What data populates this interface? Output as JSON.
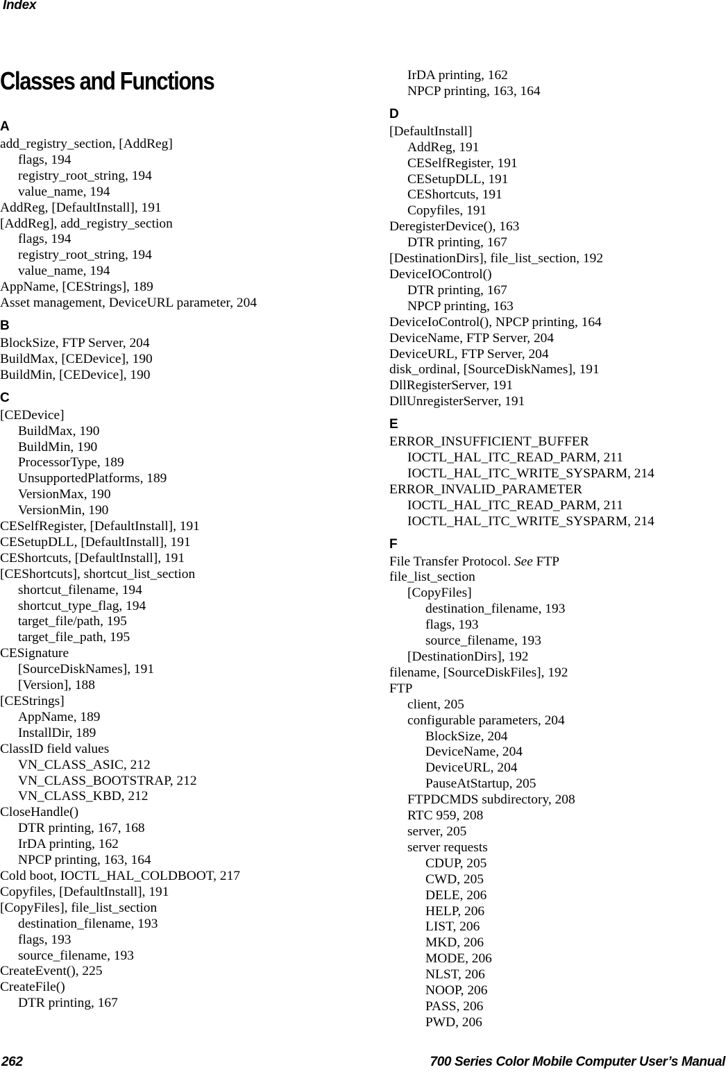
{
  "header": {
    "running_head": "Index"
  },
  "title": "Classes and Functions",
  "columns": [
    {
      "sections": [
        {
          "letter": "A",
          "entries": [
            {
              "level": 1,
              "text": "add_registry_section, [AddReg]"
            },
            {
              "level": 2,
              "text": "flags, 194"
            },
            {
              "level": 2,
              "text": "registry_root_string, 194"
            },
            {
              "level": 2,
              "text": "value_name, 194"
            },
            {
              "level": 1,
              "text": "AddReg, [DefaultInstall], 191"
            },
            {
              "level": 1,
              "text": "[AddReg], add_registry_section"
            },
            {
              "level": 2,
              "text": "flags, 194"
            },
            {
              "level": 2,
              "text": "registry_root_string, 194"
            },
            {
              "level": 2,
              "text": "value_name, 194"
            },
            {
              "level": 1,
              "text": "AppName, [CEStrings], 189"
            },
            {
              "level": 1,
              "text": "Asset management, DeviceURL parameter, 204"
            }
          ]
        },
        {
          "letter": "B",
          "entries": [
            {
              "level": 1,
              "text": "BlockSize, FTP Server, 204"
            },
            {
              "level": 1,
              "text": "BuildMax, [CEDevice], 190"
            },
            {
              "level": 1,
              "text": "BuildMin, [CEDevice], 190"
            }
          ]
        },
        {
          "letter": "C",
          "entries": [
            {
              "level": 1,
              "text": "[CEDevice]"
            },
            {
              "level": 2,
              "text": "BuildMax, 190"
            },
            {
              "level": 2,
              "text": "BuildMin, 190"
            },
            {
              "level": 2,
              "text": "ProcessorType, 189"
            },
            {
              "level": 2,
              "text": "UnsupportedPlatforms, 189"
            },
            {
              "level": 2,
              "text": "VersionMax, 190"
            },
            {
              "level": 2,
              "text": "VersionMin, 190"
            },
            {
              "level": 1,
              "text": "CESelfRegister, [DefaultInstall], 191"
            },
            {
              "level": 1,
              "text": "CESetupDLL, [DefaultInstall], 191"
            },
            {
              "level": 1,
              "text": "CEShortcuts, [DefaultInstall], 191"
            },
            {
              "level": 1,
              "text": "[CEShortcuts], shortcut_list_section"
            },
            {
              "level": 2,
              "text": "shortcut_filename, 194"
            },
            {
              "level": 2,
              "text": "shortcut_type_flag, 194"
            },
            {
              "level": 2,
              "text": "target_file/path, 195"
            },
            {
              "level": 2,
              "text": "target_file_path, 195"
            },
            {
              "level": 1,
              "text": "CESignature"
            },
            {
              "level": 2,
              "text": "[SourceDiskNames], 191"
            },
            {
              "level": 2,
              "text": "[Version], 188"
            },
            {
              "level": 1,
              "text": "[CEStrings]"
            },
            {
              "level": 2,
              "text": "AppName, 189"
            },
            {
              "level": 2,
              "text": "InstallDir, 189"
            },
            {
              "level": 1,
              "text": "ClassID field values"
            },
            {
              "level": 2,
              "text": "VN_CLASS_ASIC, 212"
            },
            {
              "level": 2,
              "text": "VN_CLASS_BOOTSTRAP, 212"
            },
            {
              "level": 2,
              "text": "VN_CLASS_KBD, 212"
            },
            {
              "level": 1,
              "text": "CloseHandle()"
            },
            {
              "level": 2,
              "text": "DTR printing, 167, 168"
            },
            {
              "level": 2,
              "text": "IrDA printing, 162"
            },
            {
              "level": 2,
              "text": "NPCP printing, 163, 164"
            },
            {
              "level": 1,
              "text": "Cold boot, IOCTL_HAL_COLDBOOT, 217"
            },
            {
              "level": 1,
              "text": "Copyfiles, [DefaultInstall], 191"
            },
            {
              "level": 1,
              "text": "[CopyFiles], file_list_section"
            },
            {
              "level": 2,
              "text": "destination_filename, 193"
            },
            {
              "level": 2,
              "text": "flags, 193"
            },
            {
              "level": 2,
              "text": "source_filename, 193"
            },
            {
              "level": 1,
              "text": "CreateEvent(), 225"
            },
            {
              "level": 1,
              "text": "CreateFile()"
            },
            {
              "level": 2,
              "text": "DTR printing, 167"
            }
          ]
        }
      ]
    },
    {
      "sections": [
        {
          "letter": "",
          "entries": [
            {
              "level": 2,
              "text": "IrDA printing, 162"
            },
            {
              "level": 2,
              "text": "NPCP printing, 163, 164"
            }
          ]
        },
        {
          "letter": "D",
          "entries": [
            {
              "level": 1,
              "text": "[DefaultInstall]"
            },
            {
              "level": 2,
              "text": "AddReg, 191"
            },
            {
              "level": 2,
              "text": "CESelfRegister, 191"
            },
            {
              "level": 2,
              "text": "CESetupDLL, 191"
            },
            {
              "level": 2,
              "text": "CEShortcuts, 191"
            },
            {
              "level": 2,
              "text": "Copyfiles, 191"
            },
            {
              "level": 1,
              "text": "DeregisterDevice(), 163"
            },
            {
              "level": 2,
              "text": "DTR printing, 167"
            },
            {
              "level": 1,
              "text": "[DestinationDirs], file_list_section, 192"
            },
            {
              "level": 1,
              "text": "DeviceIOControl()"
            },
            {
              "level": 2,
              "text": "DTR printing, 167"
            },
            {
              "level": 2,
              "text": "NPCP printing, 163"
            },
            {
              "level": 1,
              "text": "DeviceIoControl(), NPCP printing, 164"
            },
            {
              "level": 1,
              "text": "DeviceName, FTP Server, 204"
            },
            {
              "level": 1,
              "text": "DeviceURL, FTP Server, 204"
            },
            {
              "level": 1,
              "text": "disk_ordinal, [SourceDiskNames], 191"
            },
            {
              "level": 1,
              "text": "DllRegisterServer, 191"
            },
            {
              "level": 1,
              "text": "DllUnregisterServer, 191"
            }
          ]
        },
        {
          "letter": "E",
          "entries": [
            {
              "level": 1,
              "text": "ERROR_INSUFFICIENT_BUFFER"
            },
            {
              "level": 2,
              "text": "IOCTL_HAL_ITC_READ_PARM, 211"
            },
            {
              "level": 2,
              "text": "IOCTL_HAL_ITC_WRITE_SYSPARM, 214"
            },
            {
              "level": 1,
              "text": "ERROR_INVALID_PARAMETER"
            },
            {
              "level": 2,
              "text": "IOCTL_HAL_ITC_READ_PARM, 211"
            },
            {
              "level": 2,
              "text": "IOCTL_HAL_ITC_WRITE_SYSPARM, 214"
            }
          ]
        },
        {
          "letter": "F",
          "entries": [
            {
              "level": 1,
              "text": "File Transfer Protocol. ",
              "see": "See",
              "see_target": " FTP"
            },
            {
              "level": 1,
              "text": "file_list_section"
            },
            {
              "level": 2,
              "text": "[CopyFiles]"
            },
            {
              "level": 3,
              "text": "destination_filename, 193"
            },
            {
              "level": 3,
              "text": "flags, 193"
            },
            {
              "level": 3,
              "text": "source_filename, 193"
            },
            {
              "level": 2,
              "text": "[DestinationDirs], 192"
            },
            {
              "level": 1,
              "text": "filename, [SourceDiskFiles], 192"
            },
            {
              "level": 1,
              "text": "FTP"
            },
            {
              "level": 2,
              "text": "client, 205"
            },
            {
              "level": 2,
              "text": "configurable parameters, 204"
            },
            {
              "level": 3,
              "text": "BlockSize, 204"
            },
            {
              "level": 3,
              "text": "DeviceName, 204"
            },
            {
              "level": 3,
              "text": "DeviceURL, 204"
            },
            {
              "level": 3,
              "text": "PauseAtStartup, 205"
            },
            {
              "level": 2,
              "text": "FTPDCMDS subdirectory, 208"
            },
            {
              "level": 2,
              "text": "RTC 959, 208"
            },
            {
              "level": 2,
              "text": "server, 205"
            },
            {
              "level": 2,
              "text": "server requests"
            },
            {
              "level": 3,
              "text": "CDUP, 205"
            },
            {
              "level": 3,
              "text": "CWD, 205"
            },
            {
              "level": 3,
              "text": "DELE, 206"
            },
            {
              "level": 3,
              "text": "HELP, 206"
            },
            {
              "level": 3,
              "text": "LIST, 206"
            },
            {
              "level": 3,
              "text": "MKD, 206"
            },
            {
              "level": 3,
              "text": "MODE, 206"
            },
            {
              "level": 3,
              "text": "NLST, 206"
            },
            {
              "level": 3,
              "text": "NOOP, 206"
            },
            {
              "level": 3,
              "text": "PASS, 206"
            },
            {
              "level": 3,
              "text": "PWD, 206"
            }
          ]
        }
      ]
    }
  ],
  "footer": {
    "page_number": "262",
    "book_title": "700 Series Color Mobile Computer User’s Manual"
  }
}
